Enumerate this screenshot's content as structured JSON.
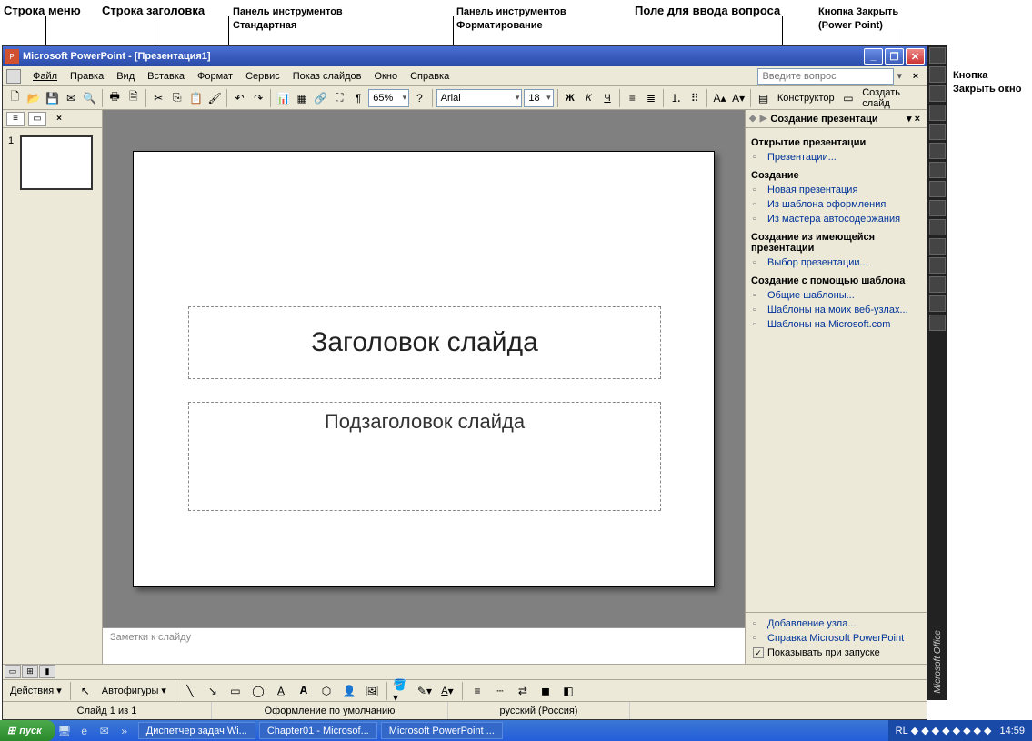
{
  "callouts": {
    "menu_row": "Строка меню",
    "title_row": "Строка заголовка",
    "toolbar_std_l1": "Панель инструментов",
    "toolbar_std_l2": "Стандартная",
    "toolbar_fmt_l1": "Панель инструментов",
    "toolbar_fmt_l2": "Форматирование",
    "question_field": "Поле для ввода вопроса",
    "close_pp_l1": "Кнопка Закрыть",
    "close_pp_l2": "(Power Point)",
    "close_doc_l1": "Кнопка",
    "close_doc_l2": "Закрыть окно"
  },
  "titlebar": {
    "text": "Microsoft PowerPoint - [Презентация1]"
  },
  "menu": {
    "file": "Файл",
    "edit": "Правка",
    "view": "Вид",
    "insert": "Вставка",
    "format": "Формат",
    "tools": "Сервис",
    "slideshow": "Показ слайдов",
    "window": "Окно",
    "help": "Справка"
  },
  "question_placeholder": "Введите вопрос",
  "toolbar": {
    "zoom": "65%",
    "font": "Arial",
    "size": "18",
    "designer": "Конструктор",
    "new_slide": "Создать слайд"
  },
  "slide": {
    "thumb_num": "1",
    "title_ph": "Заголовок слайда",
    "subtitle_ph": "Подзаголовок слайда",
    "notes_ph": "Заметки к слайду"
  },
  "taskpane": {
    "title": "Создание презентаци",
    "sec_open": "Открытие презентации",
    "link_presentations": "Презентации...",
    "sec_create": "Создание",
    "link_new": "Новая презентация",
    "link_template": "Из шаблона оформления",
    "link_wizard": "Из мастера автосодержания",
    "sec_existing_l1": "Создание из имеющейся",
    "sec_existing_l2": "презентации",
    "link_choose": "Выбор презентации...",
    "sec_with_template": "Создание с помощью шаблона",
    "link_general": "Общие шаблоны...",
    "link_web": "Шаблоны на моих веб-узлах...",
    "link_ms": "Шаблоны на Microsoft.com",
    "foot_add": "Добавление узла...",
    "foot_help": "Справка Microsoft PowerPoint",
    "foot_show": "Показывать при запуске"
  },
  "drawing": {
    "actions": "Действия",
    "autoshapes": "Автофигуры"
  },
  "status": {
    "slide": "Слайд 1 из 1",
    "design": "Оформление по умолчанию",
    "lang": "русский (Россия)"
  },
  "office_label": "Microsoft Office",
  "taskbar": {
    "start": "пуск",
    "t1": "Диспетчер задач Wi...",
    "t2": "Chapter01 - Microsof...",
    "t3": "Microsoft PowerPoint ...",
    "lang": "RL",
    "time": "14:59"
  }
}
